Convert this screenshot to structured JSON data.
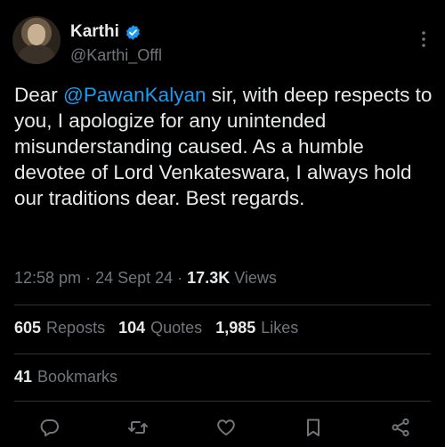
{
  "author": {
    "display_name": "Karthi",
    "handle": "@Karthi_Offl",
    "verified": true
  },
  "tweet": {
    "text_before": "Dear ",
    "mention": "@PawanKalyan",
    "text_after": " sir, with deep respects to you, I apologize for any unintended misunderstanding caused. As a humble devotee of Lord Venkateswara, I always hold our traditions dear. Best regards."
  },
  "meta": {
    "time": "12:58 pm",
    "date": "24 Sept 24",
    "views_count": "17.3K",
    "views_label": "Views"
  },
  "stats": {
    "reposts_count": "605",
    "reposts_label": "Reposts",
    "quotes_count": "104",
    "quotes_label": "Quotes",
    "likes_count": "1,985",
    "likes_label": "Likes",
    "bookmarks_count": "41",
    "bookmarks_label": "Bookmarks"
  },
  "icons": {
    "verified": "verified-badge-icon",
    "more": "more-options-icon",
    "reply": "reply-icon",
    "repost": "repost-icon",
    "like": "like-icon",
    "bookmark": "bookmark-icon",
    "share": "share-icon"
  },
  "colors": {
    "background": "#000000",
    "text": "#e7e9ea",
    "secondary": "#71767b",
    "accent": "#1d9bf0",
    "divider": "#2f3336"
  }
}
